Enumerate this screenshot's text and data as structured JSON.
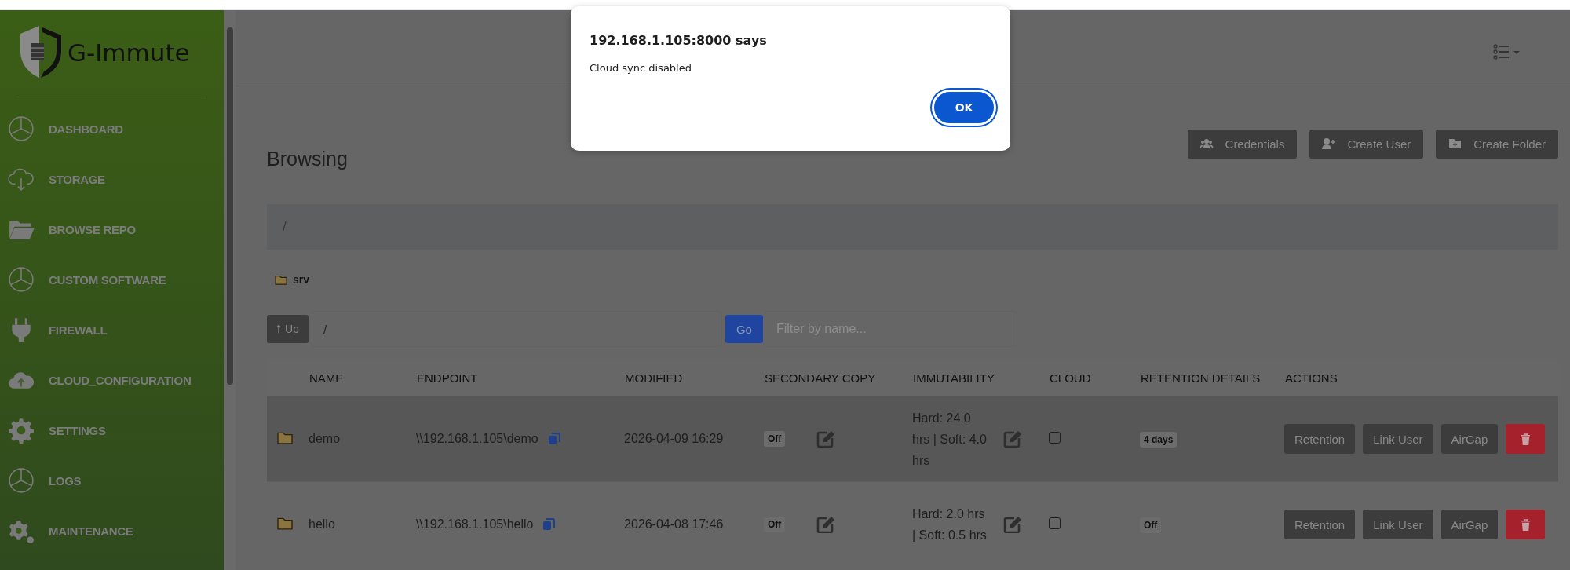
{
  "sidebar": {
    "logo_text": "G-Immute",
    "items": [
      {
        "label": "DASHBOARD"
      },
      {
        "label": "STORAGE"
      },
      {
        "label": "BROWSE REPO"
      },
      {
        "label": "CUSTOM SOFTWARE"
      },
      {
        "label": "FIREWALL"
      },
      {
        "label": "CLOUD_CONFIGURATION"
      },
      {
        "label": "SETTINGS"
      },
      {
        "label": "LOGS"
      },
      {
        "label": "MAINTENANCE"
      }
    ]
  },
  "dialog": {
    "title": "192.168.1.105:8000 says",
    "message": "Cloud sync disabled",
    "button": "OK"
  },
  "page": {
    "title": "Browsing",
    "buttons": [
      {
        "label": "Credentials"
      },
      {
        "label": "Create User"
      },
      {
        "label": "Create Folder"
      }
    ],
    "breadcrumb": "/",
    "folder": "srv",
    "up_button": "Up",
    "path_input": {
      "value": "/"
    },
    "go_button": "Go",
    "filter": {
      "placeholder": "Filter by name..."
    }
  },
  "table": {
    "columns": [
      "NAME",
      "ENDPOINT",
      "MODIFIED",
      "SECONDARY COPY",
      "IMMUTABILITY",
      "CLOUD",
      "RETENTION DETAILS",
      "ACTIONS"
    ],
    "rows": [
      {
        "name": "demo",
        "endpoint": "\\\\192.168.1.105\\demo",
        "modified": "2026-04-09 16:29",
        "secondary_copy": "Off",
        "immutability": "Hard: 24.0 hrs | Soft: 4.0 hrs",
        "cloud_checked": false,
        "retention": "4 days",
        "highlighted": true,
        "actions": [
          "Retention",
          "Link User",
          "AirGap"
        ]
      },
      {
        "name": "hello",
        "endpoint": "\\\\192.168.1.105\\hello",
        "modified": "2026-04-08 17:46",
        "secondary_copy": "Off",
        "immutability": "Hard: 2.0 hrs | Soft: 0.5 hrs",
        "cloud_checked": false,
        "retention": "Off",
        "highlighted": false,
        "actions": [
          "Retention",
          "Link User",
          "AirGap"
        ]
      }
    ]
  }
}
